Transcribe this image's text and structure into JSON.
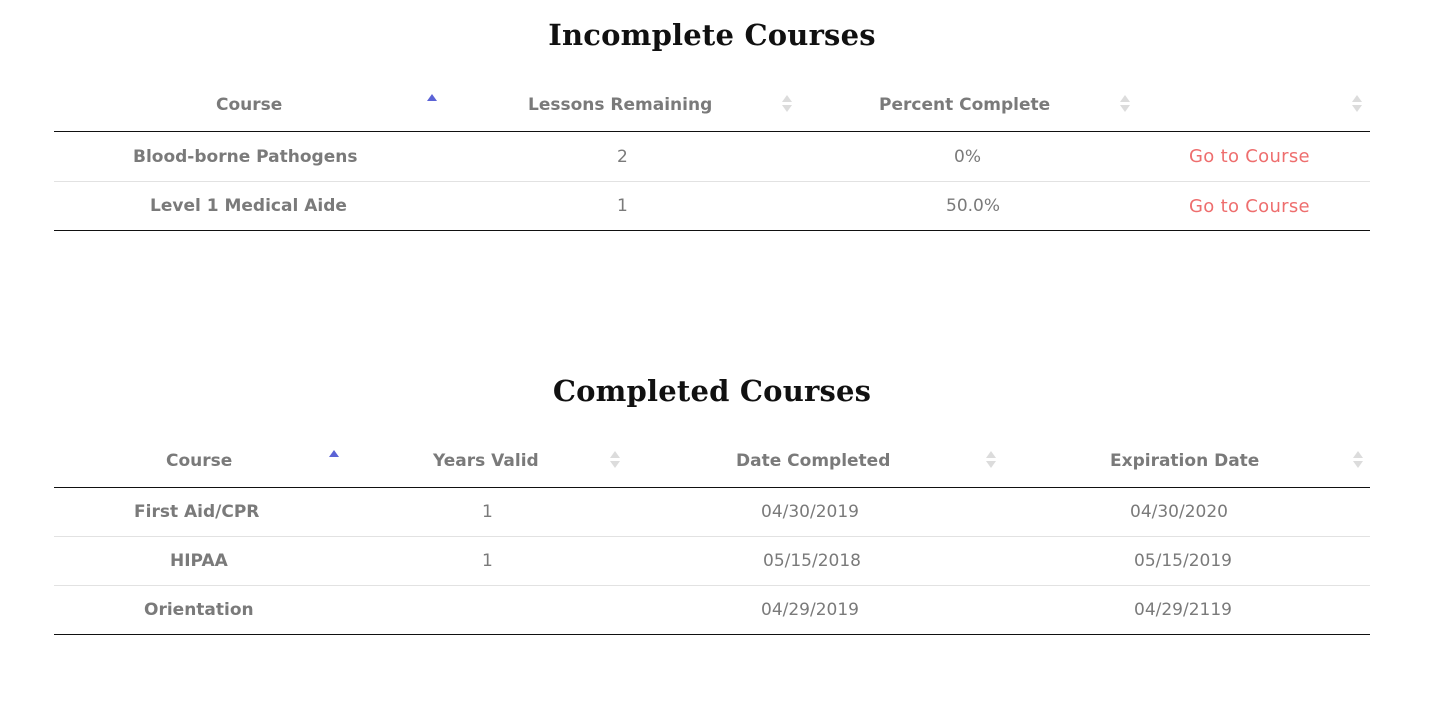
{
  "incomplete": {
    "title": "Incomplete Courses",
    "headers": [
      "Course",
      "Lessons Remaining",
      "Percent Complete",
      ""
    ],
    "rows": [
      {
        "course": "Blood-borne Pathogens",
        "lessons_remaining": "2",
        "percent_complete": "0%",
        "action": "Go to Course"
      },
      {
        "course": "Level 1 Medical Aide",
        "lessons_remaining": "1",
        "percent_complete": "50.0%",
        "action": "Go to Course"
      }
    ]
  },
  "completed": {
    "title": "Completed Courses",
    "headers": [
      "Course",
      "Years Valid",
      "Date Completed",
      "Expiration Date"
    ],
    "rows": [
      {
        "course": "First Aid/CPR",
        "years_valid": "1",
        "date_completed": "04/30/2019",
        "expiration_date": "04/30/2020",
        "expired": false
      },
      {
        "course": "HIPAA",
        "years_valid": "1",
        "date_completed": "05/15/2018",
        "expiration_date": "05/15/2019",
        "expired": true
      },
      {
        "course": "Orientation",
        "years_valid": "",
        "date_completed": "04/29/2019",
        "expiration_date": "04/29/2119",
        "expired": false
      }
    ]
  },
  "colors": {
    "sort_active": "#5b63d6",
    "sort_inactive": "#dcdcdc",
    "link": "#ee6e6e",
    "expired": "#e0201c",
    "text_muted": "#7a7a7a"
  },
  "icons": {
    "sort_ascending": "sort-ascending-icon",
    "sort_neutral": "sort-neutral-icon"
  }
}
